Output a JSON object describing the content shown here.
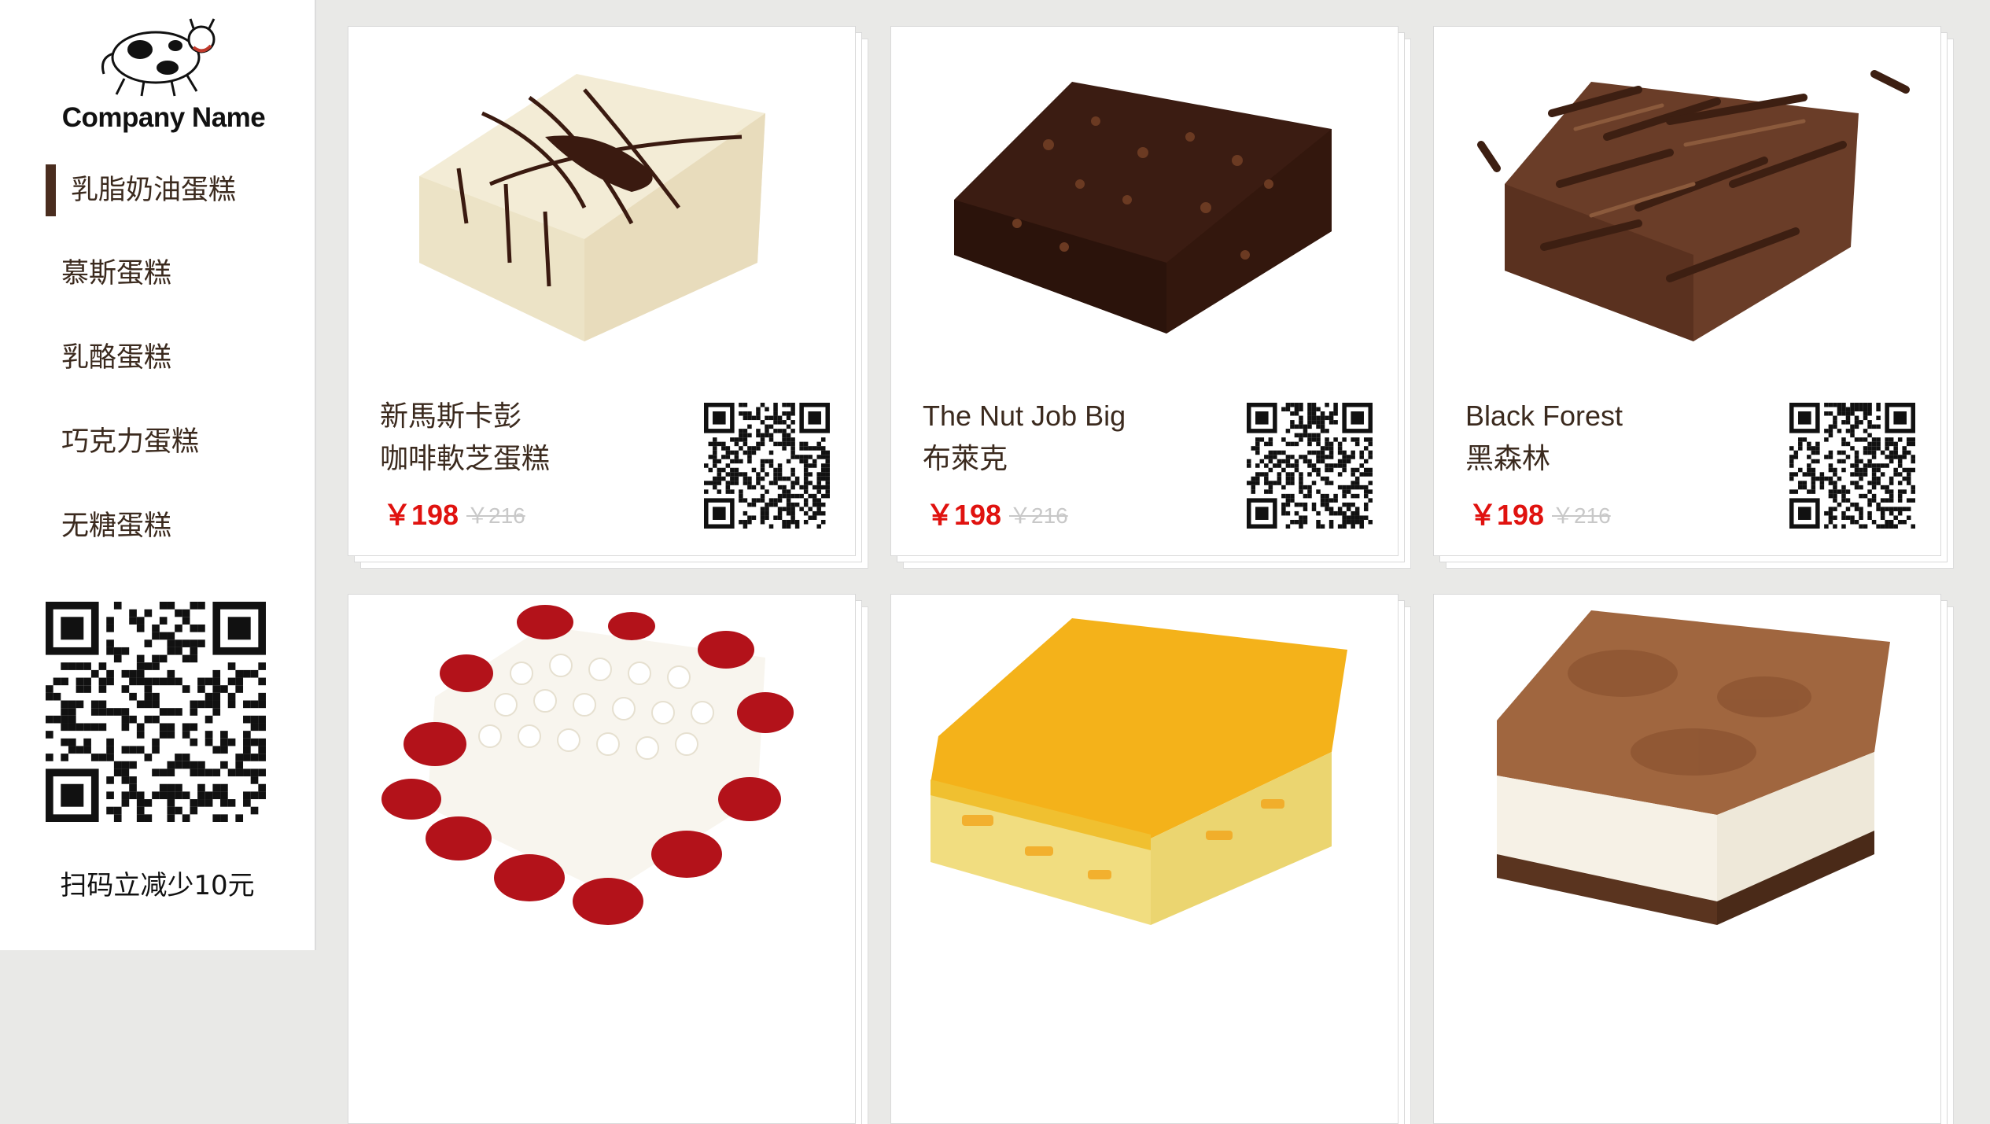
{
  "brand": {
    "name": "Company Name",
    "logo_icon": "cow-icon"
  },
  "nav": {
    "items": [
      {
        "label": "乳脂奶油蛋糕",
        "active": true
      },
      {
        "label": "慕斯蛋糕",
        "active": false
      },
      {
        "label": "乳酪蛋糕",
        "active": false
      },
      {
        "label": "巧克力蛋糕",
        "active": false
      },
      {
        "label": "无糖蛋糕",
        "active": false
      }
    ]
  },
  "sidebar": {
    "promo": "扫码立减少10元"
  },
  "products": [
    {
      "line1": "新馬斯卡彭",
      "line2": "咖啡軟芝蛋糕",
      "price": "￥198",
      "old_price": "￥216",
      "image": "cream-cake-chocolate-drizzle"
    },
    {
      "line1": "The Nut Job Big",
      "line2": "布萊克",
      "price": "￥198",
      "old_price": "￥216",
      "image": "chocolate-nut-cake"
    },
    {
      "line1": "Black Forest",
      "line2": "黑森林",
      "price": "￥198",
      "old_price": "￥216",
      "image": "black-forest-cake"
    },
    {
      "image": "red-petal-cream-cake"
    },
    {
      "image": "mango-mousse-cake"
    },
    {
      "image": "tiramisu-cake"
    }
  ],
  "colors": {
    "accent": "#4a2d1f",
    "price": "#e0120f",
    "old_price": "#c8c8c8",
    "background": "#e9e9e7"
  }
}
